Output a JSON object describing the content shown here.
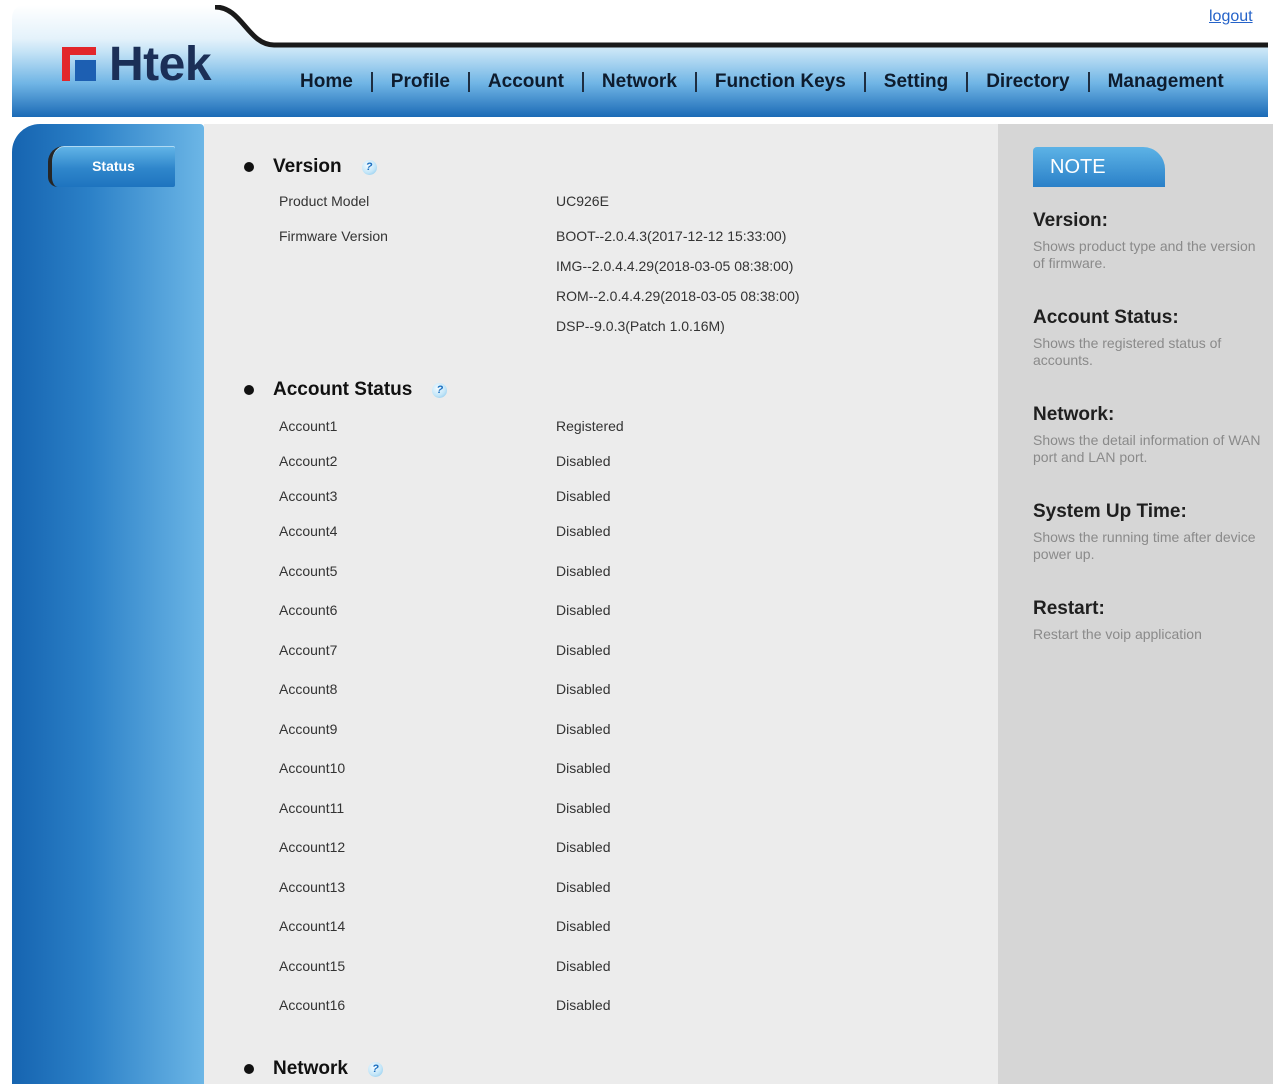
{
  "header": {
    "logo": {
      "brand": "Htek"
    },
    "logout": "logout",
    "nav": [
      {
        "label": "Home"
      },
      {
        "label": "Profile"
      },
      {
        "label": "Account"
      },
      {
        "label": "Network"
      },
      {
        "label": "Function Keys"
      },
      {
        "label": "Setting"
      },
      {
        "label": "Directory"
      },
      {
        "label": "Management"
      }
    ]
  },
  "sidebar": {
    "items": [
      {
        "label": "Status",
        "selected": true
      }
    ]
  },
  "status": {
    "version": {
      "title": "Version",
      "product_model": {
        "label": "Product Model",
        "value": "UC926E"
      },
      "firmware_version": {
        "label": "Firmware Version",
        "values": [
          "BOOT--2.0.4.3(2017-12-12 15:33:00)",
          "IMG--2.0.4.4.29(2018-03-05 08:38:00)",
          "ROM--2.0.4.4.29(2018-03-05 08:38:00)",
          "DSP--9.0.3(Patch 1.0.16M)"
        ]
      }
    },
    "account_status": {
      "title": "Account Status",
      "accounts": [
        {
          "label": "Account1",
          "state": "Registered"
        },
        {
          "label": "Account2",
          "state": "Disabled"
        },
        {
          "label": "Account3",
          "state": "Disabled"
        },
        {
          "label": "Account4",
          "state": "Disabled"
        },
        {
          "label": "Account5",
          "state": "Disabled"
        },
        {
          "label": "Account6",
          "state": "Disabled"
        },
        {
          "label": "Account7",
          "state": "Disabled"
        },
        {
          "label": "Account8",
          "state": "Disabled"
        },
        {
          "label": "Account9",
          "state": "Disabled"
        },
        {
          "label": "Account10",
          "state": "Disabled"
        },
        {
          "label": "Account11",
          "state": "Disabled"
        },
        {
          "label": "Account12",
          "state": "Disabled"
        },
        {
          "label": "Account13",
          "state": "Disabled"
        },
        {
          "label": "Account14",
          "state": "Disabled"
        },
        {
          "label": "Account15",
          "state": "Disabled"
        },
        {
          "label": "Account16",
          "state": "Disabled"
        }
      ]
    },
    "network": {
      "title": "Network"
    }
  },
  "note": {
    "title": "NOTE",
    "items": [
      {
        "heading": "Version:",
        "text": "Shows product type and the version of firmware."
      },
      {
        "heading": "Account Status:",
        "text": "Shows the registered status of accounts."
      },
      {
        "heading": "Network:",
        "text": "Shows the detail information of WAN port and LAN port."
      },
      {
        "heading": "System Up Time:",
        "text": "Shows the running time after device power up."
      },
      {
        "heading": "Restart:",
        "text": "Restart the voip application"
      }
    ]
  },
  "icons": {
    "help": "help-icon",
    "help_glyph": "?",
    "bullet": "bullet-dot-icon",
    "logo_mark": "htek-logo-mark-icon"
  },
  "colors": {
    "header_blue": "#1b6ab6",
    "sidebar_blue": "#1664b0",
    "content_bg": "#ececec",
    "note_panel_bg": "#d6d6d6",
    "link": "#2563c9",
    "logo_red": "#e2262b",
    "logo_blue": "#1d5fb2"
  }
}
